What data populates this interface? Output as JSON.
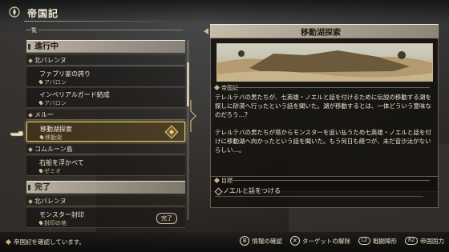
{
  "header": {
    "title": "帝国記"
  },
  "list": {
    "caption": "一覧",
    "sections": [
      {
        "label": "進行中"
      },
      {
        "label": "完了"
      }
    ],
    "regions": [
      "北バレンヌ",
      "メルー",
      "コムルーン島",
      "北バレンヌ"
    ],
    "items": [
      {
        "name": "ファブリ家の誇り",
        "place": "アバロン"
      },
      {
        "name": "インペリアルガード結成",
        "place": "アバロン"
      },
      {
        "name": "移動湖探索",
        "place": "移動湖"
      },
      {
        "name": "石船を浮かべて",
        "place": "ゼミオ"
      },
      {
        "name": "モンスター封印",
        "place": "封印の地",
        "badge": "完了"
      }
    ]
  },
  "detail": {
    "title": "移動湖探索",
    "section_label": "帝国記",
    "paragraph1": "テレルテバの男たちが、七英雄・ノエルと話を付けるために伝説の移動する湖を探しに砂漠へ行ったという話を聞いた。湖が移動するとは、一体どういう意味なのだろう…？",
    "paragraph2": "テレルテバの男たちが塔からモンスターを追い払うため七英雄・ノエルと話を付けに移動湖へ向かったという話を聞いた。もう何日も経つが、未だ音沙汰がないらしい…。",
    "goal_label": "目標",
    "goal": "ノエルと話をつける"
  },
  "footer": {
    "status": "帝国記を確認しています。",
    "controls": [
      {
        "button": "B",
        "label": "情報の確認"
      },
      {
        "button": "✕",
        "label": "ターゲットの解除"
      },
      {
        "button": "L2",
        "label": "戦闘陣形"
      },
      {
        "button": "R2",
        "label": "帝国国力"
      }
    ]
  },
  "colors": {
    "accent": "#e4c46a",
    "panel": "#1a1714",
    "text": "#efe8d3"
  }
}
